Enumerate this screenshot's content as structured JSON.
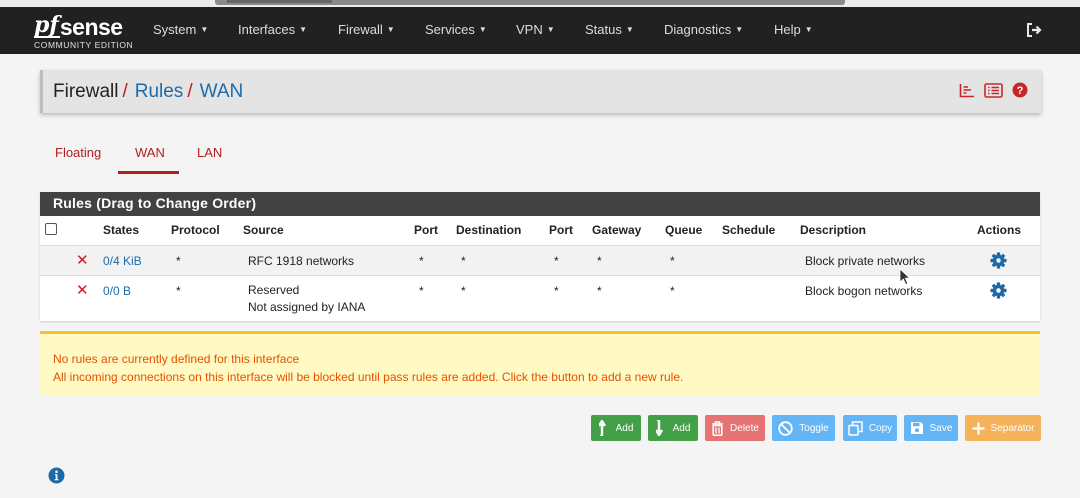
{
  "nav": {
    "brand_mark": "pf",
    "brand_name": "sense",
    "edition": "COMMUNITY EDITION",
    "items": [
      {
        "label": "System"
      },
      {
        "label": "Interfaces"
      },
      {
        "label": "Firewall"
      },
      {
        "label": "Services"
      },
      {
        "label": "VPN"
      },
      {
        "label": "Status"
      },
      {
        "label": "Diagnostics"
      },
      {
        "label": "Help"
      }
    ],
    "logout_icon": "sign-out-icon"
  },
  "breadcrumb": {
    "root": "Firewall",
    "separator": "/",
    "level1": "Rules",
    "level2": "WAN",
    "icons": [
      "bar-chart-icon",
      "list-icon",
      "help-icon"
    ]
  },
  "tabs": [
    {
      "label": "Floating",
      "active": false
    },
    {
      "label": "WAN",
      "active": true
    },
    {
      "label": "LAN",
      "active": false
    }
  ],
  "rules_panel": {
    "title": "Rules (Drag to Change Order)",
    "columns": [
      "States",
      "Protocol",
      "Source",
      "Port",
      "Destination",
      "Port",
      "Gateway",
      "Queue",
      "Schedule",
      "Description",
      "Actions"
    ],
    "rows": [
      {
        "status_icon": "times-icon",
        "states": "0/4 KiB",
        "protocol": "*",
        "source": "RFC 1918 networks",
        "source_line2": "",
        "src_port": "*",
        "destination": "*",
        "dst_port": "*",
        "gateway": "*",
        "queue": "*",
        "schedule": "",
        "description": "Block private networks",
        "action_icon": "gear-icon"
      },
      {
        "status_icon": "times-icon",
        "states": "0/0 B",
        "protocol": "*",
        "source": "Reserved",
        "source_line2": "Not assigned by IANA",
        "src_port": "*",
        "destination": "*",
        "dst_port": "*",
        "gateway": "*",
        "queue": "*",
        "schedule": "",
        "description": "Block bogon networks",
        "action_icon": "gear-icon"
      }
    ]
  },
  "alert": {
    "line1": "No rules are currently defined for this interface",
    "line2": "All incoming connections on this interface will be blocked until pass rules are added. Click the button to add a new rule."
  },
  "buttons": {
    "add_top": "Add",
    "add_bottom": "Add",
    "delete": "Delete",
    "toggle": "Toggle",
    "copy": "Copy",
    "save": "Save",
    "separator": "Separator"
  },
  "colors": {
    "navbar": "#212121",
    "accent_red": "#b01f1f",
    "link_blue": "#1e6aa8",
    "alert_bg": "#fff9c4",
    "alert_text": "#e65100"
  }
}
